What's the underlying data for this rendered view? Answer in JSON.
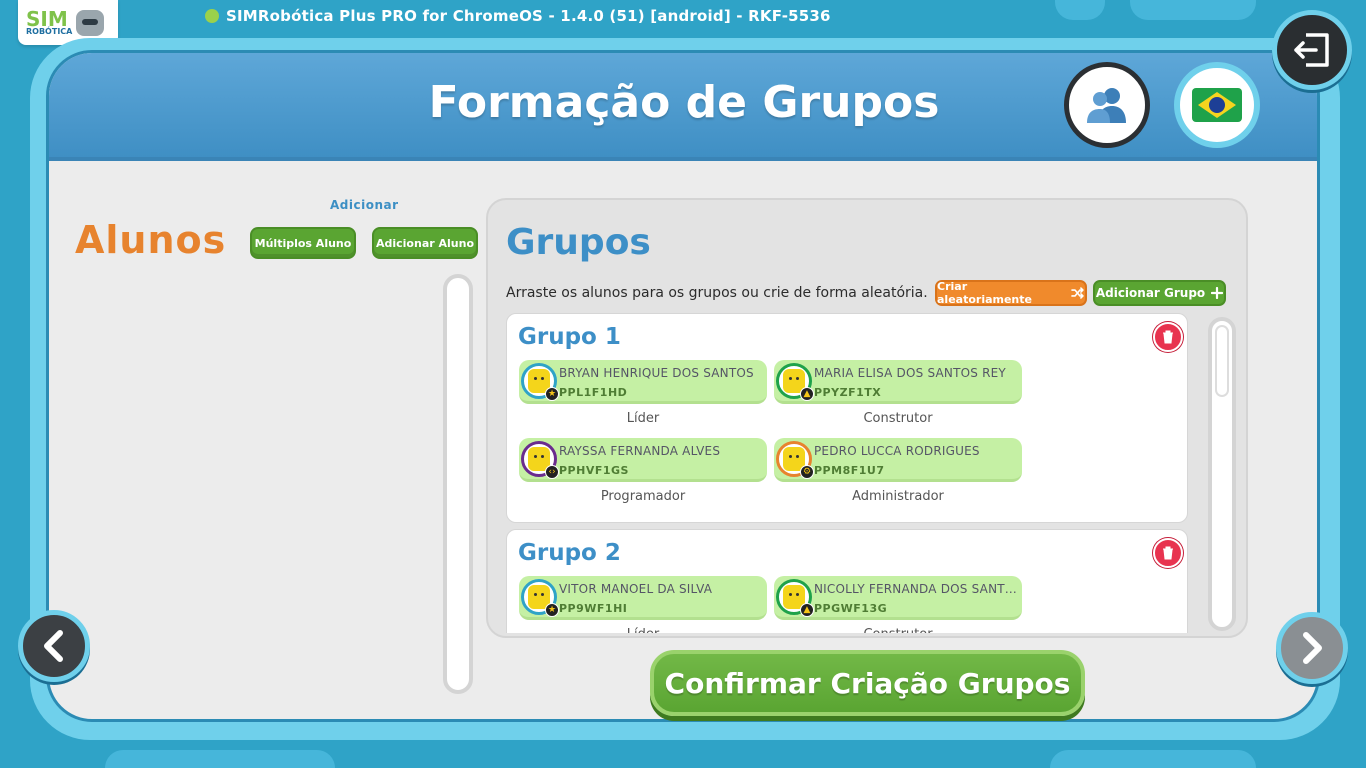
{
  "window": {
    "title": "SIMRobótica Plus PRO for ChromeOS - 1.4.0 (51) [android] - RKF-5536",
    "status_color": "#9bd14b"
  },
  "logo": {
    "line1": "SIM",
    "line2": "ROBÓTICA"
  },
  "header": {
    "title": "Formação de Grupos"
  },
  "alunos": {
    "title": "Alunos",
    "add_label": "Adicionar",
    "multi_button": "Múltiplos Aluno",
    "add_button": "Adicionar Aluno"
  },
  "grupos": {
    "title": "Grupos",
    "hint": "Arraste os alunos para os grupos ou crie de forma aleatória.",
    "random_button": "Criar aleatoriamente",
    "add_group_button": "Adicionar Grupo",
    "groups": [
      {
        "name": "Grupo 1",
        "members": [
          {
            "name": "BRYAN HENRIQUE DOS SANTOS",
            "code": "PPL1F1HD",
            "role": "Líder",
            "avatar_color": "#2fa3c7"
          },
          {
            "name": "MARIA ELISA DOS SANTOS REY",
            "code": "PPYZF1TX",
            "role": "Construtor",
            "avatar_color": "#1fa24a"
          },
          {
            "name": "RAYSSA FERNANDA ALVES",
            "code": "PPHVF1GS",
            "role": "Programador",
            "avatar_color": "#6a2c8e"
          },
          {
            "name": "PEDRO LUCCA RODRIGUES",
            "code": "PPM8F1U7",
            "role": "Administrador",
            "avatar_color": "#e7832e"
          }
        ]
      },
      {
        "name": "Grupo 2",
        "members": [
          {
            "name": "VITOR MANOEL DA SILVA",
            "code": "PP9WF1HI",
            "role": "Líder",
            "avatar_color": "#2fa3c7"
          },
          {
            "name": "NICOLLY FERNANDA DOS SANTOS",
            "code": "PPGWF13G",
            "role": "Construtor",
            "avatar_color": "#1fa24a"
          }
        ]
      }
    ]
  },
  "confirm_button": "Confirmar Criação Grupos",
  "icons": {
    "exit": "exit-icon",
    "users": "users-icon",
    "flag": "brazil-flag-icon",
    "prev": "chevron-left-icon",
    "next": "chevron-right-icon",
    "trash": "trash-icon",
    "shuffle": "shuffle-icon",
    "plus": "plus-icon"
  }
}
